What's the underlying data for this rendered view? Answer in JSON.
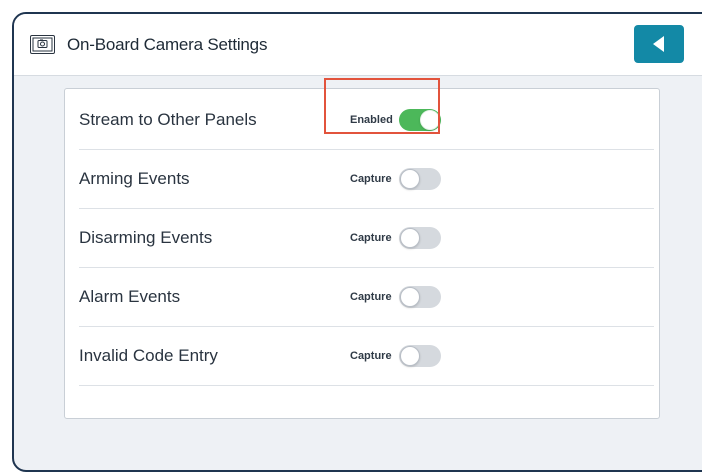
{
  "header": {
    "title": "On-Board Camera Settings",
    "icon": "camera-icon",
    "back_icon": "back-arrow-icon"
  },
  "settings": [
    {
      "label": "Stream to Other Panels",
      "state_label": "Enabled",
      "on": true
    },
    {
      "label": "Arming Events",
      "state_label": "Capture",
      "on": false
    },
    {
      "label": "Disarming Events",
      "state_label": "Capture",
      "on": false
    },
    {
      "label": "Alarm Events",
      "state_label": "Capture",
      "on": false
    },
    {
      "label": "Invalid Code Entry",
      "state_label": "Capture",
      "on": false
    }
  ],
  "colors": {
    "accent": "#1389a6",
    "toggle_on": "#4cb85a",
    "toggle_off": "#d5d9de",
    "highlight": "#e2533c",
    "frame": "#1f3550"
  }
}
